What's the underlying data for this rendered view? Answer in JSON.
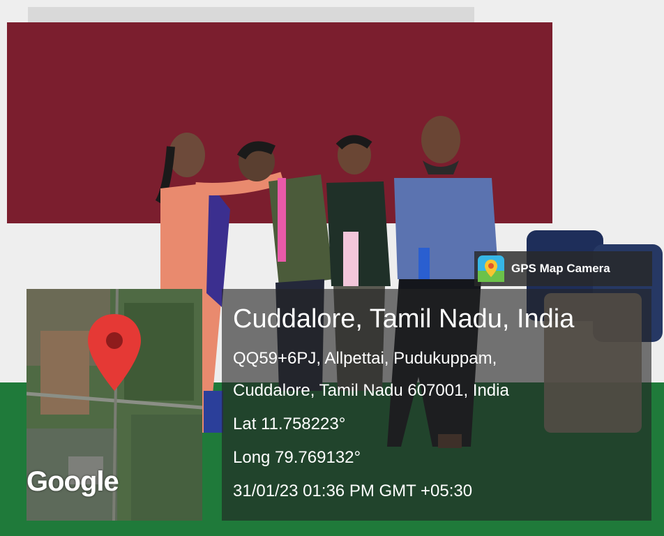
{
  "badge": {
    "icon": "gps-map-camera-icon",
    "label": "GPS Map Camera"
  },
  "location": {
    "title": "Cuddalore, Tamil Nadu, India",
    "address_line1": "QQ59+6PJ, Allpettai, Pudukuppam,",
    "address_line2": "Cuddalore, Tamil Nadu 607001, India",
    "latitude": "Lat 11.758223°",
    "longitude": "Long 79.769132°",
    "timestamp": "31/01/23 01:36 PM GMT +05:30"
  },
  "map": {
    "logo": "Google",
    "pin_icon": "map-pin-icon",
    "pin_color": "#e53935"
  },
  "colors": {
    "board": "#7b1e2e",
    "wall": "#f3f3f3",
    "floor": "#1f7a3a"
  }
}
